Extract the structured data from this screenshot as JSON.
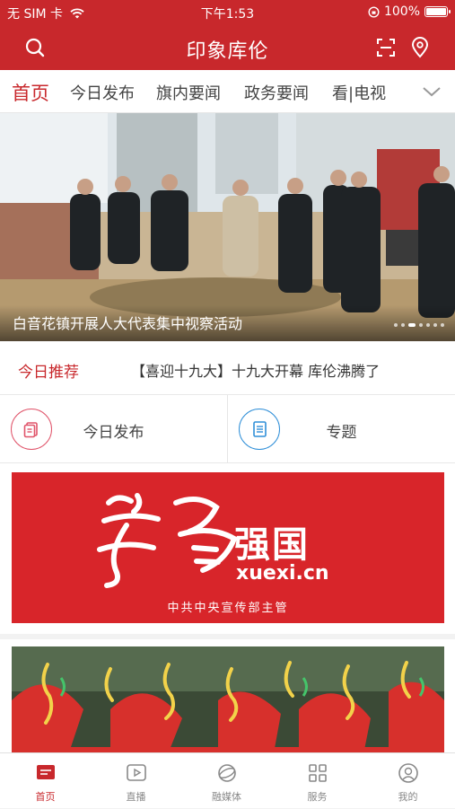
{
  "status_bar": {
    "carrier": "无 SIM 卡",
    "time": "下午1:53",
    "battery": "100%"
  },
  "header": {
    "title": "印象库伦"
  },
  "tabs": [
    "首页",
    "今日发布",
    "旗内要闻",
    "政务要闻",
    "看|电视"
  ],
  "banner": {
    "caption": "白音花镇开展人大代表集中视察活动",
    "slide_count": 7,
    "active_slide": 2
  },
  "recommend": {
    "tag": "今日推荐",
    "headline": "【喜迎十九大】十九大开幕 库伦沸腾了"
  },
  "quick_links": [
    {
      "label": "今日发布",
      "icon": "document-icon",
      "color": "#e0546a"
    },
    {
      "label": "专题",
      "icon": "list-icon",
      "color": "#2f8fd8"
    }
  ],
  "xuexi_card": {
    "title": "强国",
    "url": "xuexi.cn",
    "subtitle": "中共中央宣传部主管"
  },
  "bottom_nav": [
    {
      "label": "首页",
      "icon": "home-icon",
      "active": true
    },
    {
      "label": "直播",
      "icon": "play-icon",
      "active": false
    },
    {
      "label": "融媒体",
      "icon": "globe-icon",
      "active": false
    },
    {
      "label": "服务",
      "icon": "grid-icon",
      "active": false
    },
    {
      "label": "我的",
      "icon": "user-icon",
      "active": false
    }
  ],
  "colors": {
    "brand_red": "#c8282c",
    "xuexi_red": "#d8252a"
  }
}
